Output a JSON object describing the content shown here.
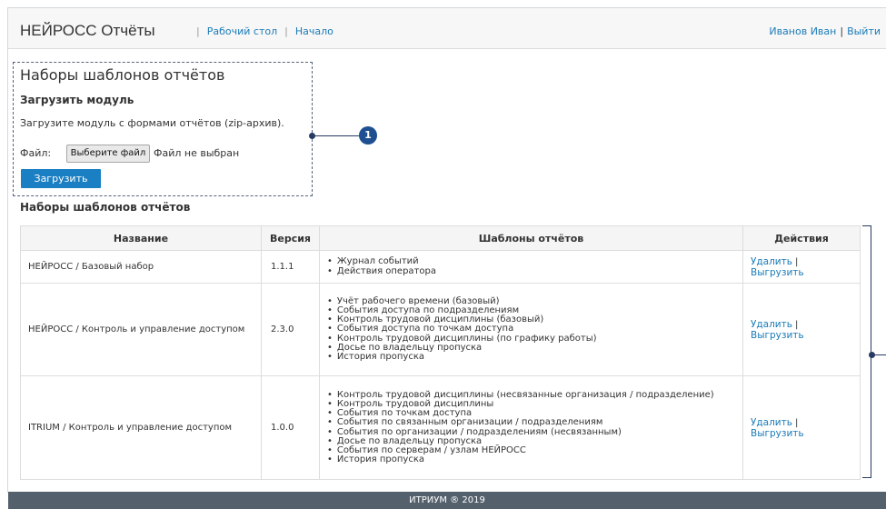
{
  "header": {
    "title": "НЕЙРОСС Отчёты",
    "nav": [
      "Рабочий стол",
      "Начало"
    ],
    "user": "Иванов Иван",
    "logout": "Выйти"
  },
  "upload": {
    "heading": "Наборы шаблонов отчётов",
    "subheading": "Загрузить модуль",
    "description": "Загрузите модуль с формами отчётов (zip-архив).",
    "file_label": "Файл:",
    "choose_button": "Выберите файл",
    "no_file": "Файл не выбран",
    "submit": "Загрузить"
  },
  "callouts": [
    "1"
  ],
  "table": {
    "title": "Наборы шаблонов отчётов",
    "columns": [
      "Название",
      "Версия",
      "Шаблоны отчётов",
      "Действия"
    ],
    "delete_label": "Удалить",
    "export_label": "Выгрузить",
    "rows": [
      {
        "name": "НЕЙРОСС / Базовый набор",
        "version": "1.1.1",
        "templates": [
          "Журнал событий",
          "Действия оператора"
        ]
      },
      {
        "name": "НЕЙРОСС / Контроль и управление доступом",
        "version": "2.3.0",
        "templates": [
          "Учёт рабочего времени (базовый)",
          "События доступа по подразделениям",
          "Контроль трудовой дисциплины (базовый)",
          "События доступа по точкам доступа",
          "Контроль трудовой дисциплины (по графику работы)",
          "Досье по владельцу пропуска",
          "История пропуска"
        ]
      },
      {
        "name": "ITRIUM / Контроль и управление доступом",
        "version": "1.0.0",
        "templates": [
          "Контроль трудовой дисциплины (несвязанные организация / подразделение)",
          "Контроль трудовой дисциплины",
          "События по точкам доступа",
          "События по связанным организации / подразделениям",
          "События по организации / подразделениям (несвязанным)",
          "Досье по владельцу пропуска",
          "События по серверам / узлам НЕЙРОСС",
          "История пропуска"
        ]
      }
    ]
  },
  "footer": {
    "text": "ИТРИУМ ® 2019"
  }
}
